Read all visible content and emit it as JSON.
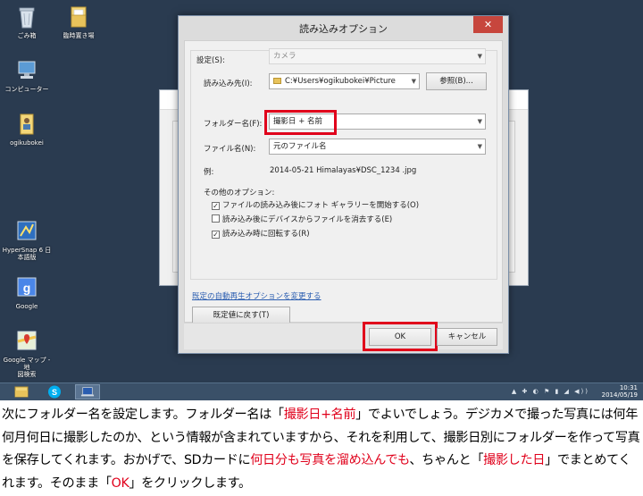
{
  "desktop": {
    "icons": [
      {
        "label": "ごみ箱",
        "icon": "recycle-bin-icon"
      },
      {
        "label": "臨時置き場",
        "icon": "folder-icon"
      },
      {
        "label": "コンピューター",
        "icon": "computer-icon"
      },
      {
        "label": "ogikubokei",
        "icon": "user-folder-icon"
      },
      {
        "label": "HyperSnap 6 日\n本語版",
        "icon": "hypersnap-icon"
      },
      {
        "label": "Google",
        "icon": "google-icon"
      },
      {
        "label": "Google マップ - 地\n図検索",
        "icon": "google-maps-icon"
      }
    ]
  },
  "dialog": {
    "title": "読み込みオプション",
    "close_glyph": "✕",
    "settings_label": "設定(S):",
    "settings_value": "カメラ",
    "import_to_label": "読み込み先(I):",
    "import_to_value": "C:¥Users¥ogikubokei¥Picture",
    "browse_label": "参照(B)...",
    "folder_name_label": "フォルダー名(F):",
    "folder_name_value": "撮影日 + 名前",
    "file_name_label": "ファイル名(N):",
    "file_name_value": "元のファイル名",
    "example_label": "例:",
    "example_value": "2014-05-21 Himalayas¥DSC_1234 .jpg",
    "other_options_label": "その他のオプション:",
    "options": [
      {
        "label": "ファイルの読み込み後にフォト ギャラリーを開始する(O)",
        "checked": true
      },
      {
        "label": "読み込み後にデバイスからファイルを消去する(E)",
        "checked": false
      },
      {
        "label": "読み込み時に回転する(R)",
        "checked": true
      }
    ],
    "autoplay_link": "既定の自動再生オプションを変更する",
    "reset_label": "既定値に戻す(T)",
    "ok_label": "OK",
    "cancel_label": "キャンセル"
  },
  "taskbar": {
    "apps": [
      "file-explorer-icon",
      "skype-icon",
      "photo-import-icon"
    ],
    "time": "10:31",
    "date": "2014/05/19",
    "tray_icons": "▲ ✚ ◐ ⚑ ▮ ◢ ◀))"
  },
  "caption": {
    "parts": [
      {
        "text": "次にフォルダー名を設定します。フォルダー名は「",
        "red": false
      },
      {
        "text": "撮影日+名前",
        "red": true
      },
      {
        "text": "」でよいでしょう。デジカメで撮った写真には何年何月何日に撮影したのか、という情報が含まれていますから、それを利用して、撮影日別にフォルダーを作って写真を保存してくれます。おかげで、SDカードに",
        "red": false
      },
      {
        "text": "何日分も写真を溜め込んでも",
        "red": true
      },
      {
        "text": "、ちゃんと「",
        "red": false
      },
      {
        "text": "撮影した日",
        "red": true
      },
      {
        "text": "」でまとめてくれます。そのまま「",
        "red": false
      },
      {
        "text": "OK",
        "red": true
      },
      {
        "text": "」をクリックします。",
        "red": false
      }
    ]
  },
  "colors": {
    "highlight": "#e0001b",
    "desktop_bg": "#2a3b50",
    "dialog_bg": "#f0f0f0",
    "close_button": "#c7463d"
  }
}
